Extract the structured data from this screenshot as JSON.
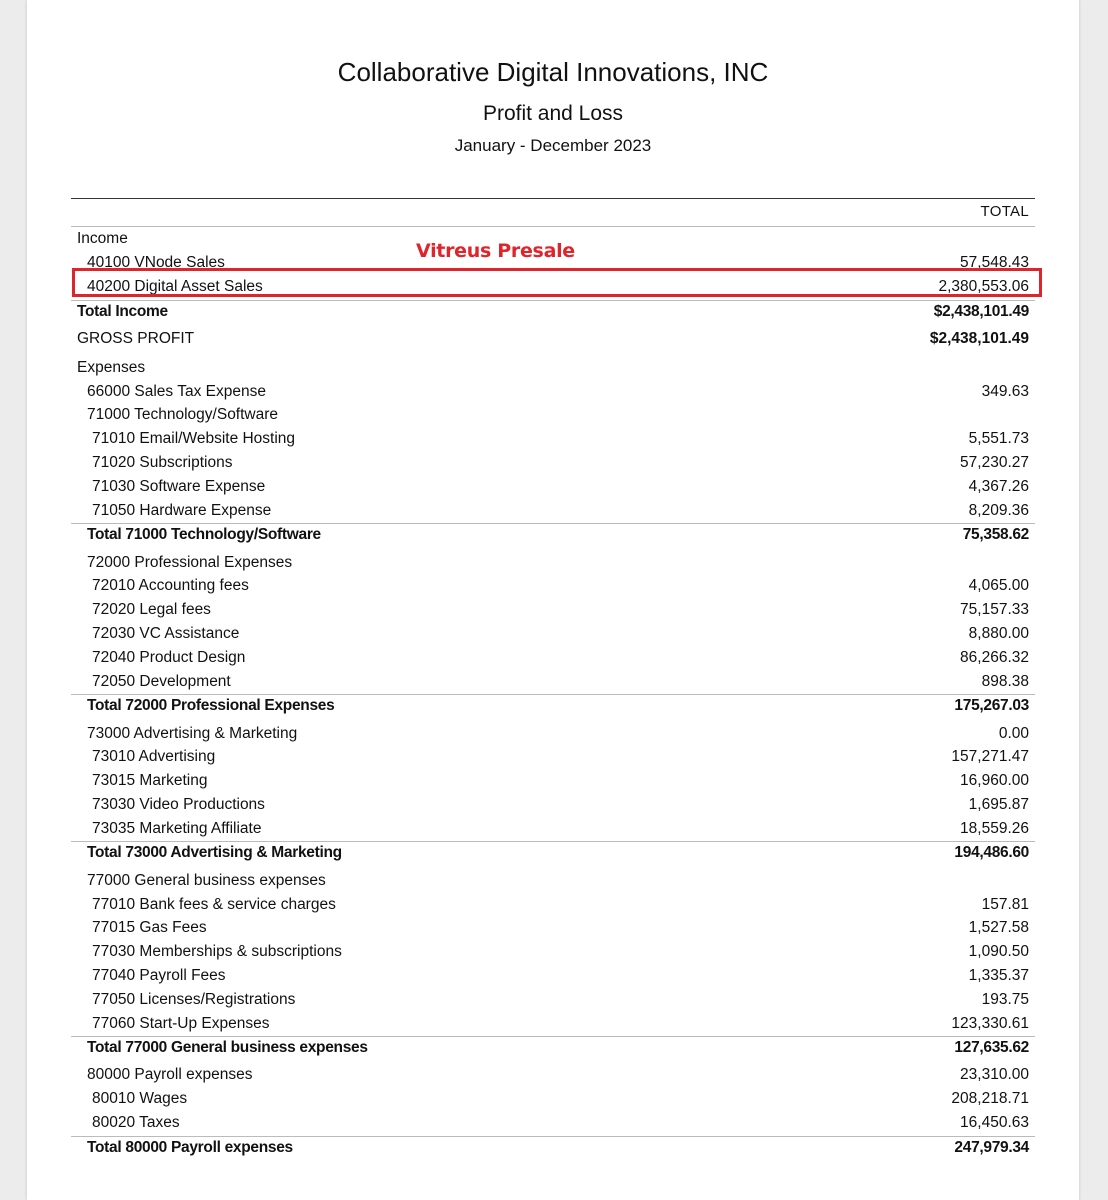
{
  "header": {
    "company": "Collaborative Digital Innovations, INC",
    "title": "Profit and Loss",
    "period": "January - December 2023",
    "column": "TOTAL"
  },
  "annotation": {
    "text": "Vitreus Presale",
    "color": "#e0242b"
  },
  "rows": [
    {
      "label": "Income",
      "amount": "",
      "level": 1,
      "bold": false,
      "rule": false
    },
    {
      "label": "40100 VNode Sales",
      "amount": "57,548.43",
      "level": 2,
      "bold": false,
      "rule": false
    },
    {
      "label": "40200 Digital Asset Sales",
      "amount": "2,380,553.06",
      "level": 2,
      "bold": false,
      "rule": false
    },
    {
      "label": "Total Income",
      "amount": "$2,438,101.49",
      "level": 1,
      "bold": true,
      "rule": true
    },
    {
      "label": "GROSS PROFIT",
      "amount": "$2,438,101.49",
      "level": 1,
      "bold": false,
      "rule": false,
      "amount_bold": true
    },
    {
      "label": "Expenses",
      "amount": "",
      "level": 1,
      "bold": false,
      "rule": false
    },
    {
      "label": "66000 Sales Tax Expense",
      "amount": "349.63",
      "level": 2,
      "bold": false,
      "rule": false
    },
    {
      "label": "71000 Technology/Software",
      "amount": "",
      "level": 2,
      "bold": false,
      "rule": false
    },
    {
      "label": "71010 Email/Website Hosting",
      "amount": "5,551.73",
      "level": 3,
      "bold": false,
      "rule": false
    },
    {
      "label": "71020 Subscriptions",
      "amount": "57,230.27",
      "level": 3,
      "bold": false,
      "rule": false
    },
    {
      "label": "71030 Software Expense",
      "amount": "4,367.26",
      "level": 3,
      "bold": false,
      "rule": false
    },
    {
      "label": "71050 Hardware Expense",
      "amount": "8,209.36",
      "level": 3,
      "bold": false,
      "rule": false
    },
    {
      "label": "Total 71000 Technology/Software",
      "amount": "75,358.62",
      "level": 2,
      "bold": true,
      "rule": true
    },
    {
      "label": "72000 Professional Expenses",
      "amount": "",
      "level": 2,
      "bold": false,
      "rule": false
    },
    {
      "label": "72010 Accounting fees",
      "amount": "4,065.00",
      "level": 3,
      "bold": false,
      "rule": false
    },
    {
      "label": "72020 Legal fees",
      "amount": "75,157.33",
      "level": 3,
      "bold": false,
      "rule": false
    },
    {
      "label": "72030 VC Assistance",
      "amount": "8,880.00",
      "level": 3,
      "bold": false,
      "rule": false
    },
    {
      "label": "72040 Product Design",
      "amount": "86,266.32",
      "level": 3,
      "bold": false,
      "rule": false
    },
    {
      "label": "72050 Development",
      "amount": "898.38",
      "level": 3,
      "bold": false,
      "rule": false
    },
    {
      "label": "Total 72000 Professional Expenses",
      "amount": "175,267.03",
      "level": 2,
      "bold": true,
      "rule": true
    },
    {
      "label": "73000 Advertising & Marketing",
      "amount": "0.00",
      "level": 2,
      "bold": false,
      "rule": false
    },
    {
      "label": "73010 Advertising",
      "amount": "157,271.47",
      "level": 3,
      "bold": false,
      "rule": false
    },
    {
      "label": "73015 Marketing",
      "amount": "16,960.00",
      "level": 3,
      "bold": false,
      "rule": false
    },
    {
      "label": "73030 Video Productions",
      "amount": "1,695.87",
      "level": 3,
      "bold": false,
      "rule": false
    },
    {
      "label": "73035 Marketing Affiliate",
      "amount": "18,559.26",
      "level": 3,
      "bold": false,
      "rule": false
    },
    {
      "label": "Total 73000 Advertising & Marketing",
      "amount": "194,486.60",
      "level": 2,
      "bold": true,
      "rule": true
    },
    {
      "label": "77000 General business expenses",
      "amount": "",
      "level": 2,
      "bold": false,
      "rule": false
    },
    {
      "label": "77010 Bank fees & service charges",
      "amount": "157.81",
      "level": 3,
      "bold": false,
      "rule": false
    },
    {
      "label": "77015 Gas Fees",
      "amount": "1,527.58",
      "level": 3,
      "bold": false,
      "rule": false
    },
    {
      "label": "77030 Memberships & subscriptions",
      "amount": "1,090.50",
      "level": 3,
      "bold": false,
      "rule": false
    },
    {
      "label": "77040 Payroll Fees",
      "amount": "1,335.37",
      "level": 3,
      "bold": false,
      "rule": false
    },
    {
      "label": "77050 Licenses/Registrations",
      "amount": "193.75",
      "level": 3,
      "bold": false,
      "rule": false
    },
    {
      "label": "77060 Start-Up Expenses",
      "amount": "123,330.61",
      "level": 3,
      "bold": false,
      "rule": false
    },
    {
      "label": "Total 77000 General business expenses",
      "amount": "127,635.62",
      "level": 2,
      "bold": true,
      "rule": true
    },
    {
      "label": "80000 Payroll expenses",
      "amount": "23,310.00",
      "level": 2,
      "bold": false,
      "rule": false
    },
    {
      "label": "80010 Wages",
      "amount": "208,218.71",
      "level": 3,
      "bold": false,
      "rule": false
    },
    {
      "label": "80020 Taxes",
      "amount": "16,450.63",
      "level": 3,
      "bold": false,
      "rule": false
    },
    {
      "label": "Total 80000 Payroll expenses",
      "amount": "247,979.34",
      "level": 2,
      "bold": true,
      "rule": true
    }
  ]
}
